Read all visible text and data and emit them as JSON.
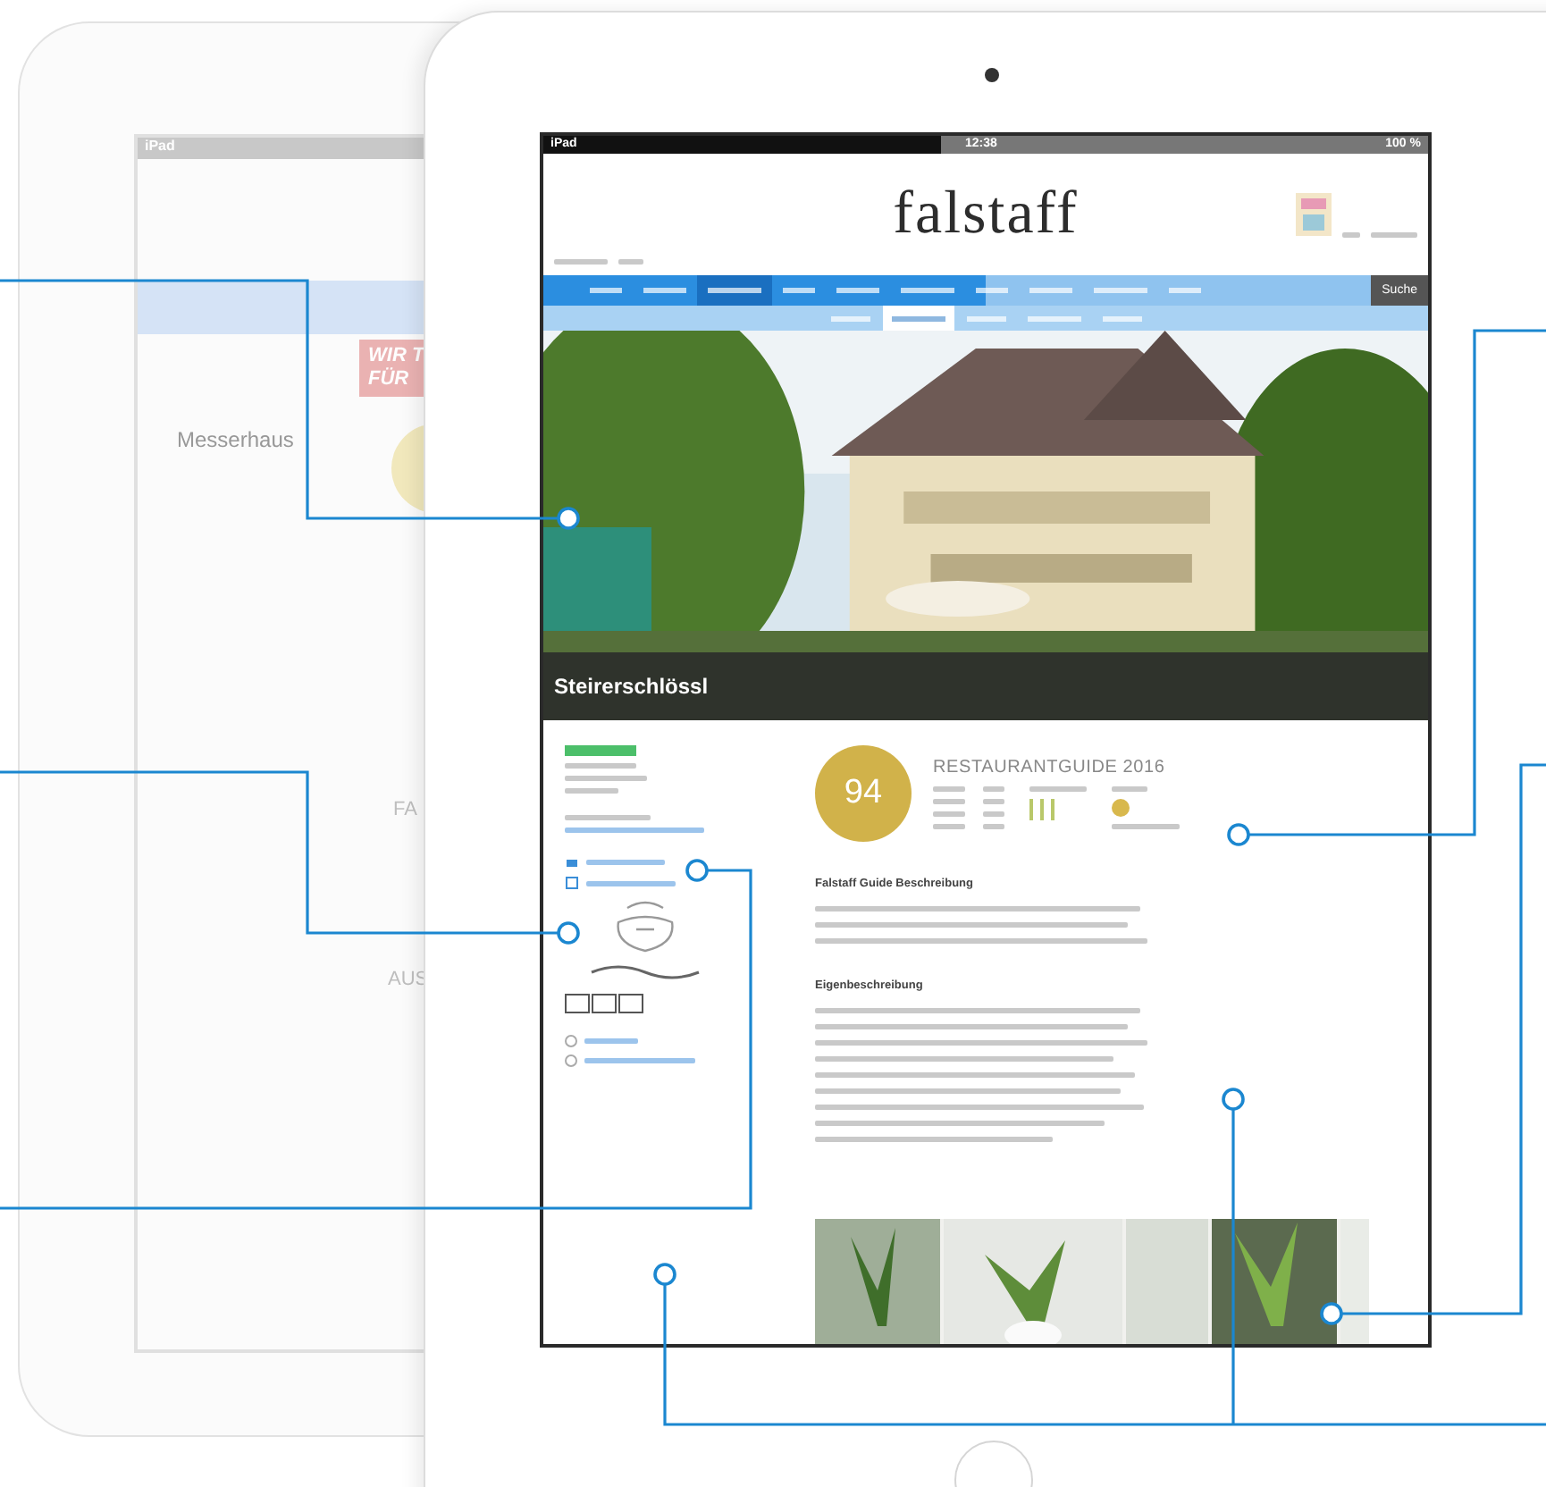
{
  "back_device": {
    "carrier": "iPad",
    "banner": [
      "WIR T",
      "FÜR"
    ],
    "venue": "Messerhaus",
    "headings": [
      "FA",
      "AUS"
    ]
  },
  "device": {
    "status_bar": {
      "carrier": "iPad",
      "time": "12:38",
      "battery": "100 %"
    },
    "site": {
      "logo": "falstaff",
      "nav": {
        "items": [
          {
            "selected": false
          },
          {
            "selected": false
          },
          {
            "selected": true
          },
          {
            "selected": false
          },
          {
            "selected": false
          },
          {
            "selected": false
          },
          {
            "selected": false
          },
          {
            "selected": false
          },
          {
            "selected": false
          },
          {
            "selected": false
          }
        ],
        "search": "Suche"
      },
      "subnav": [
        {
          "selected": false
        },
        {
          "selected": true
        },
        {
          "selected": false
        },
        {
          "selected": false
        },
        {
          "selected": false
        }
      ],
      "hero": {
        "kind": "picture",
        "title": "Steirerschlössl"
      },
      "score": {
        "points": "94",
        "guide": "RESTAURANTGUIDE 2016"
      },
      "sections": [
        {
          "heading": "Falstaff Guide Beschreibung"
        },
        {
          "heading": "Eigenbeschreibung"
        }
      ]
    }
  }
}
